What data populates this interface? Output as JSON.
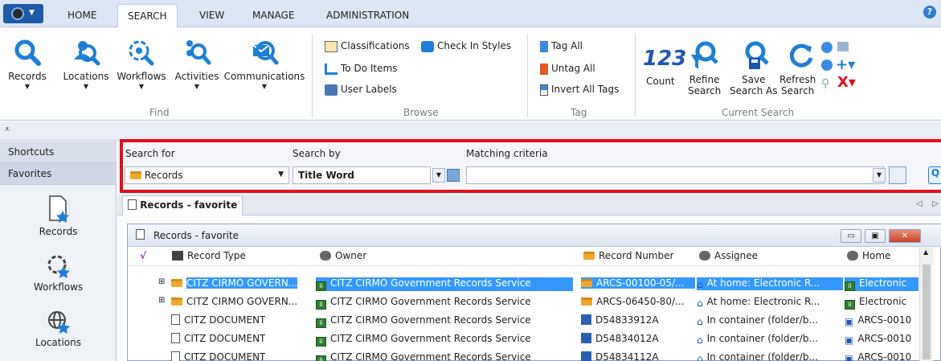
{
  "ribbon_tabs": {
    "home": "HOME",
    "search": "SEARCH",
    "view": "VIEW",
    "manage": "MANAGE",
    "administration": "ADMINISTRATION"
  },
  "help": "?",
  "find_group": {
    "label": "Find",
    "records": "Records",
    "locations": "Locations",
    "workflows": "Workflows",
    "activities": "Activities",
    "communications": "Communications"
  },
  "browse_group": {
    "label": "Browse",
    "classifications": "Classifications",
    "check_in_styles": "Check In Styles",
    "to_do_items": "To Do Items",
    "user_labels": "User Labels"
  },
  "tag_group": {
    "label": "Tag",
    "tag_all": "Tag All",
    "untag_all": "Untag All",
    "invert_all_tags": "Invert All Tags"
  },
  "current_search_group": {
    "label": "Current Search",
    "count_glyph": "123",
    "count": "Count",
    "refine_1": "Refine",
    "refine_2": "Search",
    "save_1": "Save",
    "save_2": "Search As",
    "refresh_1": "Refresh",
    "refresh_2": "Search"
  },
  "leftnav": {
    "shortcuts": "Shortcuts",
    "favorites": "Favorites",
    "records": "Records",
    "workflows": "Workflows",
    "locations": "Locations"
  },
  "search": {
    "search_for_label": "Search for",
    "search_by_label": "Search by",
    "matching_label": "Matching criteria",
    "search_for_value": "Records",
    "search_by_value": "Title Word",
    "matching_value": ""
  },
  "doc_tab": "Records - favorite",
  "window_title": "Records - favorite",
  "columns": {
    "check": "√",
    "record_type": "Record Type",
    "owner": "Owner",
    "record_number": "Record Number",
    "assignee": "Assignee",
    "home": "Home"
  },
  "rows": [
    {
      "type": "CITZ CIRMO GOVERN...",
      "owner": "CITZ CIRMO Government Records Service",
      "number": "ARCS-00100-05/...",
      "assignee": "At home: Electronic R...",
      "home": "Electronic"
    },
    {
      "type": "CITZ CIRMO GOVERN...",
      "owner": "CITZ CIRMO Government Records Service",
      "number": "ARCS-06450-80/...",
      "assignee": "At home: Electronic R...",
      "home": "Electronic"
    },
    {
      "type": "CITZ DOCUMENT",
      "owner": "CITZ CIRMO Government Records Service",
      "number": "D54833912A",
      "assignee": "In container (folder/b...",
      "home": "ARCS-0010"
    },
    {
      "type": "CITZ DOCUMENT",
      "owner": "CITZ CIRMO Government Records Service",
      "number": "D54834012A",
      "assignee": "In container (folder/b...",
      "home": "ARCS-0010"
    },
    {
      "type": "CITZ DOCUMENT",
      "owner": "CITZ CIRMO Government Records Service",
      "number": "D54834112A",
      "assignee": "In container (folder/b...",
      "home": "ARCS-0010"
    }
  ],
  "colors": {
    "accent": "#1e7fd6",
    "highlight": "#e2101b",
    "selection": "#3399ff"
  }
}
